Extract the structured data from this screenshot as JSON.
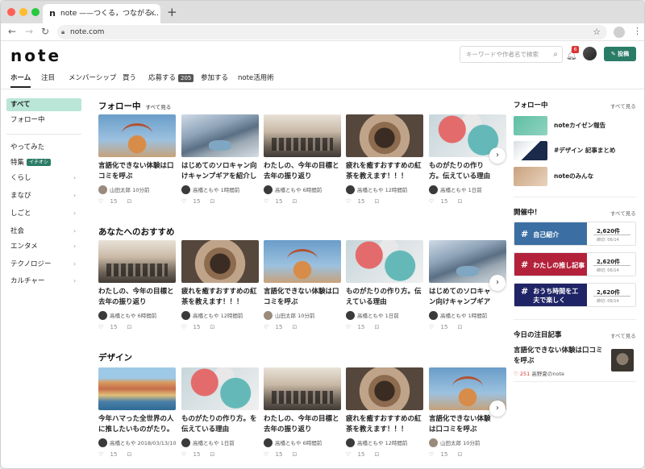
{
  "browser": {
    "tab_title": "note ——つくる，つながる…",
    "tab_close": "×",
    "new_tab": "+",
    "favicon": "n",
    "url": "note.com",
    "colors": {
      "dot_red": "#fe5f57",
      "dot_yellow": "#febc2e",
      "dot_green": "#28c840"
    }
  },
  "header": {
    "logo": "note",
    "search_placeholder": "キーワードや作者名で検索",
    "notification_count": "6",
    "post_label": "投稿",
    "accent": "#2b7c66"
  },
  "nav": {
    "items": [
      "ホーム",
      "注目",
      "メンバーシップ",
      "買う",
      "応募する",
      "参加する",
      "note活用術"
    ],
    "apply_badge": "205"
  },
  "sidebar": {
    "items": [
      "すべて",
      "フォロー中",
      "やってみた",
      "特集",
      "くらし",
      "まなび",
      "しごと",
      "社会",
      "エンタメ",
      "テクノロジー",
      "カルチャー"
    ],
    "feature_badge": "イチオシ"
  },
  "sections": [
    {
      "title": "フォロー中",
      "see_all": "すべて見る",
      "cards": [
        {
          "title": "言語化できない体験は口コミを呼ぶ",
          "author": "山田太郎",
          "time": "10分前",
          "likes": "15",
          "thumb": "carousel"
        },
        {
          "title": "はじめてのソロキャン向けキャンプギアを紹介します",
          "author": "高橋ともや",
          "time": "1時間前",
          "likes": "15",
          "thumb": "mountain"
        },
        {
          "title": "わたしの、今年の目標と去年の振り返り",
          "author": "高橋ともや",
          "time": "6時間前",
          "likes": "15",
          "thumb": "crowd"
        },
        {
          "title": "疲れを癒すおすすめの紅茶を教えます！！！",
          "author": "高橋ともや",
          "time": "12時間前",
          "likes": "15",
          "thumb": "food"
        },
        {
          "title": "ものがたりの作り方。伝えている理由",
          "author": "高橋ともや",
          "time": "1日前",
          "likes": "15",
          "thumb": "balls"
        }
      ]
    },
    {
      "title": "あなたへのおすすめ",
      "see_all": "",
      "cards": [
        {
          "title": "わたしの、今年の目標と去年の振り返り",
          "author": "高橋ともや",
          "time": "6時間前",
          "likes": "15",
          "thumb": "crowd"
        },
        {
          "title": "疲れを癒すおすすめの紅茶を教えます！！！",
          "author": "高橋ともや",
          "time": "12時間前",
          "likes": "15",
          "thumb": "food"
        },
        {
          "title": "言語化できない体験は口コミを呼ぶ",
          "author": "山田太郎",
          "time": "10分前",
          "likes": "15",
          "thumb": "carousel"
        },
        {
          "title": "ものがたりの作り方。伝えている理由",
          "author": "高橋ともや",
          "time": "1日前",
          "likes": "15",
          "thumb": "balls"
        },
        {
          "title": "はじめてのソロキャン向けキャンプギアを紹介します",
          "author": "高橋ともや",
          "time": "1時間前",
          "likes": "15",
          "thumb": "mountain"
        }
      ]
    },
    {
      "title": "デザイン",
      "see_all": "",
      "cards": [
        {
          "title": "今年ハマった全世界の人に推したいものがたり。",
          "author": "高橋ともや",
          "time": "2018/03/13/10",
          "likes": "15",
          "thumb": "town"
        },
        {
          "title": "ものがたりの作り方。を伝えている理由",
          "author": "高橋ともや",
          "time": "1日前",
          "likes": "15",
          "thumb": "balls"
        },
        {
          "title": "わたしの、今年の目標と去年の振り返り",
          "author": "高橋ともや",
          "time": "6時間前",
          "likes": "15",
          "thumb": "crowd"
        },
        {
          "title": "疲れを癒すおすすめの紅茶を教えます！！！",
          "author": "高橋ともや",
          "time": "12時間前",
          "likes": "15",
          "thumb": "food"
        },
        {
          "title": "言語化できない体験は口コミを呼ぶ",
          "author": "山田太郎",
          "time": "10分前",
          "likes": "15",
          "thumb": "carousel"
        }
      ]
    }
  ],
  "right": {
    "following_title": "フォロー中",
    "see_all": "すべて見る",
    "magazines": [
      "noteカイゼン報告",
      "#デザイン 記事まとめ",
      "noteのみんな"
    ],
    "events_title": "開催中！",
    "events": [
      {
        "tag": "自己紹介",
        "count": "2,620件",
        "until": "締切: 06/14",
        "color": "#3b6fa3"
      },
      {
        "tag": "わたしの推し記事",
        "count": "2,620件",
        "until": "締切: 06/14",
        "color": "#b3223a"
      },
      {
        "tag": "おうち時間を工夫で楽しく",
        "count": "2,620件",
        "until": "締切: 06/14",
        "color": "#1f2466"
      }
    ],
    "hot_title": "今日の注目記事",
    "hot_article": "言語化できない体験は口コミを呼ぶ",
    "hot_likes": "251",
    "hot_author": "高野夏のnote"
  }
}
